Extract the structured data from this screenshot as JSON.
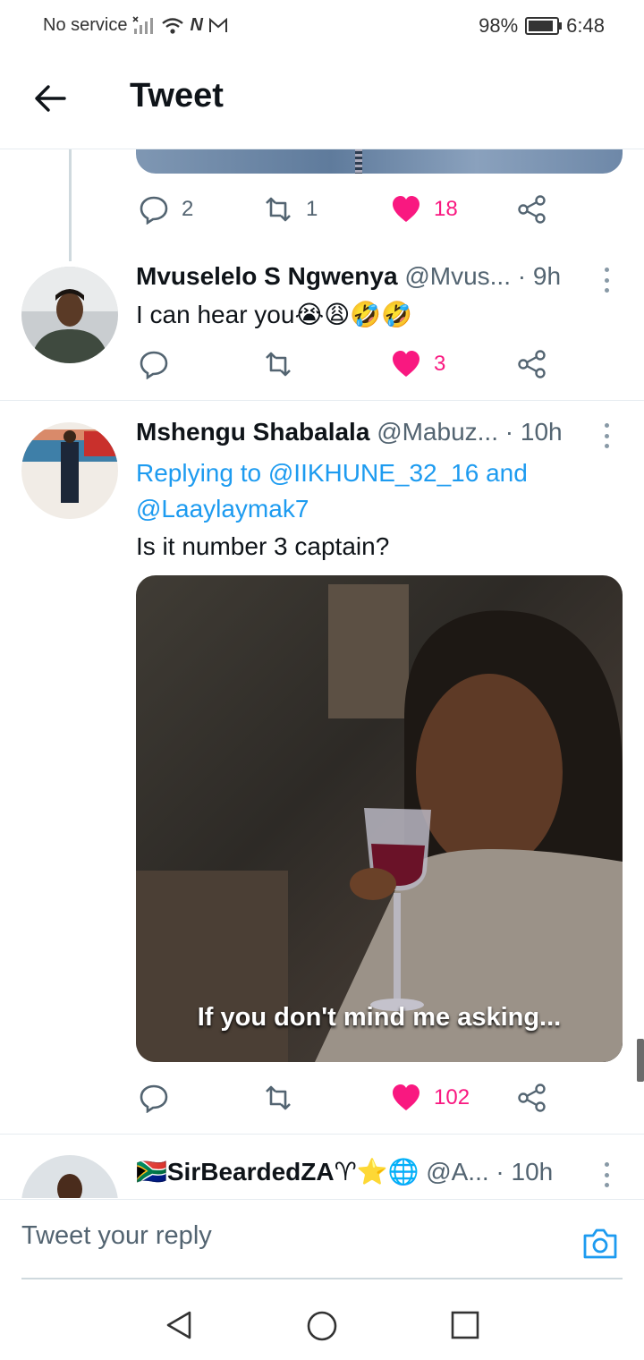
{
  "status_bar": {
    "carrier": "No service",
    "net_badge": "N",
    "battery": "98%",
    "time": "6:48"
  },
  "header": {
    "title": "Tweet"
  },
  "prev_tweet_actions": {
    "replies": "2",
    "retweets": "1",
    "likes": "18"
  },
  "tweets": [
    {
      "name": "Mvuselelo S Ngwenya",
      "handle": "@Mvus...",
      "time": "· 9h",
      "text": "I can hear you",
      "emojis": "😭😩🤣🤣",
      "replies": "",
      "retweets": "",
      "likes": "3"
    },
    {
      "name": "Mshengu Shabalala",
      "handle": "@Mabuz...",
      "time": "· 10h",
      "replying_prefix": "Replying to",
      "replying_user1": "@IIKHUNE_32_16",
      "replying_and": "and",
      "replying_user2": "@Laaylaymak7",
      "text": "Is it number 3 captain?",
      "image_caption": "If you don't mind me asking...",
      "replies": "",
      "retweets": "",
      "likes": "102"
    },
    {
      "name": "SirBeardedZA",
      "name_flag": "🇿🇦",
      "name_emojis": "♈⭐🌐",
      "handle": "@A...",
      "time": "· 10h"
    }
  ],
  "reply_bar": {
    "placeholder": "Tweet your reply"
  },
  "colors": {
    "like": "#f91880",
    "link": "#1d9bf0",
    "muted": "#536471"
  },
  "icons": [
    "back-arrow-icon",
    "reply-icon",
    "retweet-icon",
    "heart-icon",
    "share-icon",
    "more-icon",
    "camera-icon",
    "nav-back-icon",
    "nav-home-icon",
    "nav-recents-icon"
  ]
}
